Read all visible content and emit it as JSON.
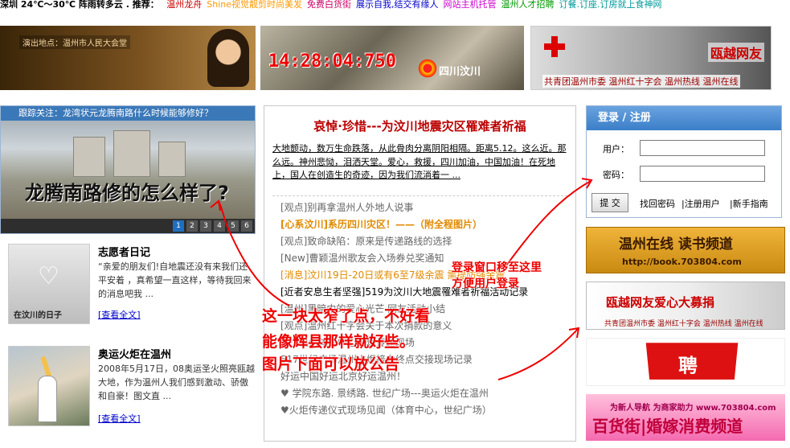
{
  "topbar": {
    "weather": "深圳 24℃～30℃ 阵雨转多云 . 推荐：",
    "links": [
      {
        "text": "温州龙舟",
        "color": "#cc0000"
      },
      {
        "text": "Shine视觉靓剪时尚美发",
        "color": "#ff9900"
      },
      {
        "text": "免费白货街",
        "color": "#cc0066"
      },
      {
        "text": "展示自我,结交有缘人",
        "color": "#0000cc"
      },
      {
        "text": "网站主机托管",
        "color": "#cc00cc"
      },
      {
        "text": "温州人才招聘",
        "color": "#009900"
      },
      {
        "text": "订餐.订座.订房就上食神网",
        "color": "#009999"
      }
    ]
  },
  "banners": {
    "b1_caption": "演出地点：温州市人民大会堂",
    "b2_clock": "14:28:04:750",
    "b2_location": "四川汶川",
    "b3_brand": "瓯越网友",
    "b3_links": "共青团温州市委 温州红十字会 温州热线 温州在线"
  },
  "feature": {
    "heading": "跟踪关注：龙湾状元龙腾南路什么时候能够修好？",
    "big_text": "龙腾南路修的怎么样了?",
    "pager": [
      "1",
      "2",
      "3",
      "4",
      "5",
      "6"
    ]
  },
  "side": [
    {
      "title": "志愿者日记",
      "text": "“亲爱的朋友们!自地震还没有来我们还平安着 ，真希望一直这样，等待我回来的消息吧我 ...",
      "more": "[查看全文]",
      "thumb_tag": "在汶川的日子"
    },
    {
      "title": "奥运火炬在温州",
      "text": "2008年5月17日，08奥运圣火照亮瓯越大地，作为温州人我们感到激动、骄傲和自豪！图文直 ...",
      "more": "[查看全文]"
    }
  ],
  "center": {
    "title": "哀悼·珍惜---为汶川地震灾区罹难者祈福",
    "lead": "大地颤动，数万生命跌落，从此骨肉分离阴阳相隔。距离5.12。这么近。那么远。神州悲恸，泪洒天堂。爱心，救援，四川加油，中国加油！在死地上，国人在创造生的奇迹，因为我们流淌着一 ...",
    "news": [
      "[观点]别再拿温州人外地人说事",
      "[心系汶川]系历四川灾区！——（附全程图片）",
      "[观点]致命缺陷：原来是传递路线的选择",
      "[New]曹颖温州歌友会入场券兑奖通知",
      "[消息]汶川19日-20日或有6至7级余震 需提防强余震",
      "[近者安息生者坚强]519为汶川大地震罹难者祈福活动记录",
      "[温州]黑暗中的爱心光芒 网友活动小结",
      "[观点]温州红十字会关于本次捐款的意义",
      "517温州体育中心火炬传递现场",
      "517世纪广场温州火炬接力终点交接现场记录",
      "好运中国好运北京好运温州！",
      "♥ 学院东路. 景绣路. 世纪广场---奥运火炬在温州",
      "♥火炬传递仪式现场见闻（体育中心，世纪广场）"
    ]
  },
  "login": {
    "header": "登录 / 注册",
    "user_label": "用户：",
    "pass_label": "密码：",
    "submit": "提 交",
    "links": [
      "找回密码",
      "|注册用户",
      "|新手指南"
    ]
  },
  "ads": {
    "ad1_title": "温州在线 读书频道",
    "ad1_url": "http://book.703804.com",
    "ad2_title": "瓯越网友爱心大募捐",
    "ad2_sub": "共青团温州市委 温州红十字会 温州热线 温州在线",
    "ad3_text": "聘",
    "ad4_sub": "为新人导航 为商家助力 www.703804.com",
    "ad4_title": "百货街|婚嫁消费频道"
  },
  "annotations": {
    "main_lines": [
      "这一块太窄了点，不好看",
      "能像辉县那样就好些。",
      "图片下面可以放公告"
    ],
    "login_lines": [
      "登录窗口移至这里",
      "方便用户登录"
    ],
    "color": "#e00000"
  }
}
